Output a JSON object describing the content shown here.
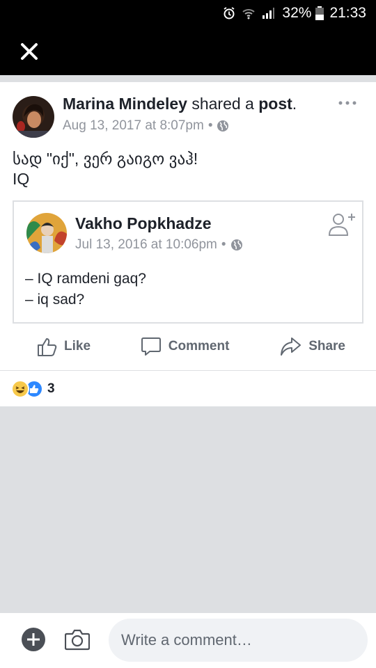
{
  "status_bar": {
    "battery": "32%",
    "time": "21:33"
  },
  "post": {
    "author": "Marina Mindeley",
    "action_text": " shared a ",
    "action_object": "post",
    "period": ".",
    "timestamp": "Aug 13, 2017 at 8:07pm",
    "separator": "•",
    "text": "სად \"იქ\", ვერ გაიგო ვაჰ!\nIQ",
    "shared": {
      "author": "Vakho Popkhadze",
      "timestamp": "Jul 13, 2016 at 10:06pm",
      "separator": "•",
      "text": "– IQ ramdeni gaq?\n– iq sad?"
    },
    "actions": {
      "like": "Like",
      "comment": "Comment",
      "share": "Share"
    }
  },
  "reactions": {
    "count": "3",
    "icons": [
      "haha-icon",
      "like-icon"
    ]
  },
  "comment_bar": {
    "placeholder": "Write a comment…"
  },
  "colors": {
    "muted": "#90949c",
    "text": "#1d2129",
    "like_blue": "#2d88ff",
    "haha_yellow": "#f7c94b"
  }
}
